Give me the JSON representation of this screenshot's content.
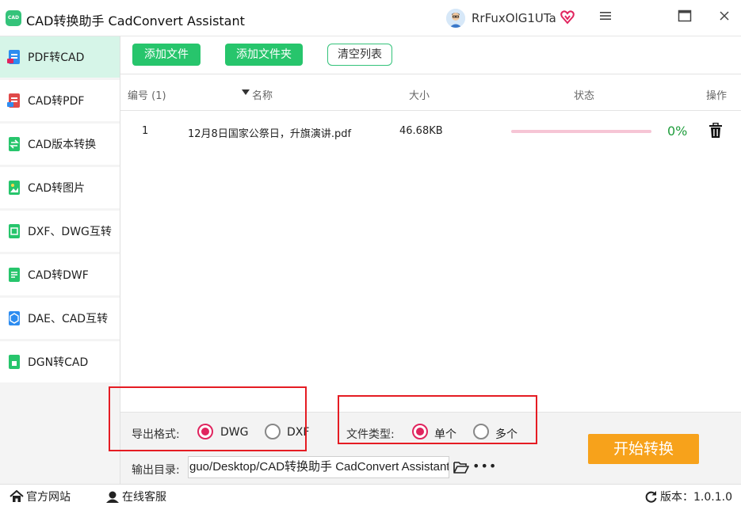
{
  "app": {
    "logo_text": "CAD",
    "title": "CAD转换助手 CadConvert Assistant",
    "user_name": "RrFuxOlG1UTa"
  },
  "sidebar": {
    "items": [
      {
        "label": "PDF转CAD",
        "icon": "pdf-to-cad-icon",
        "active": true
      },
      {
        "label": "CAD转PDF",
        "icon": "cad-to-pdf-icon"
      },
      {
        "label": "CAD版本转换",
        "icon": "cad-version-icon"
      },
      {
        "label": "CAD转图片",
        "icon": "cad-to-image-icon"
      },
      {
        "label": "DXF、DWG互转",
        "icon": "dxf-dwg-icon"
      },
      {
        "label": "CAD转DWF",
        "icon": "cad-to-dwf-icon"
      },
      {
        "label": "DAE、CAD互转",
        "icon": "dae-cad-icon"
      },
      {
        "label": "DGN转CAD",
        "icon": "dgn-to-cad-icon"
      }
    ]
  },
  "toolbar": {
    "add_file": "添加文件",
    "add_folder": "添加文件夹",
    "clear_list": "清空列表"
  },
  "table": {
    "headers": {
      "index": "编号 (1)",
      "name": "名称",
      "size": "大小",
      "status": "状态",
      "action": "操作"
    },
    "rows": [
      {
        "index": "1",
        "name": "12月8日国家公祭日，升旗演讲.pdf",
        "size": "46.68KB",
        "progress": 0,
        "progress_text": "0%"
      }
    ]
  },
  "options": {
    "format_label": "导出格式:",
    "format_options": [
      "DWG",
      "DXF"
    ],
    "format_selected": "DWG",
    "filetype_label": "文件类型:",
    "filetype_options": [
      "单个",
      "多个"
    ],
    "filetype_selected": "单个",
    "output_label": "输出目录:",
    "output_path": "guo/Desktop/CAD转换助手 CadConvert Assistant",
    "more": "•••",
    "start_button": "开始转换"
  },
  "footer": {
    "website": "官方网站",
    "support": "在线客服",
    "version": "版本：1.0.1.0"
  },
  "colors": {
    "accent_green": "#27c56c",
    "start_orange": "#f7a21b",
    "radio_red": "#e0245e",
    "annotation_red": "#e51c23"
  }
}
